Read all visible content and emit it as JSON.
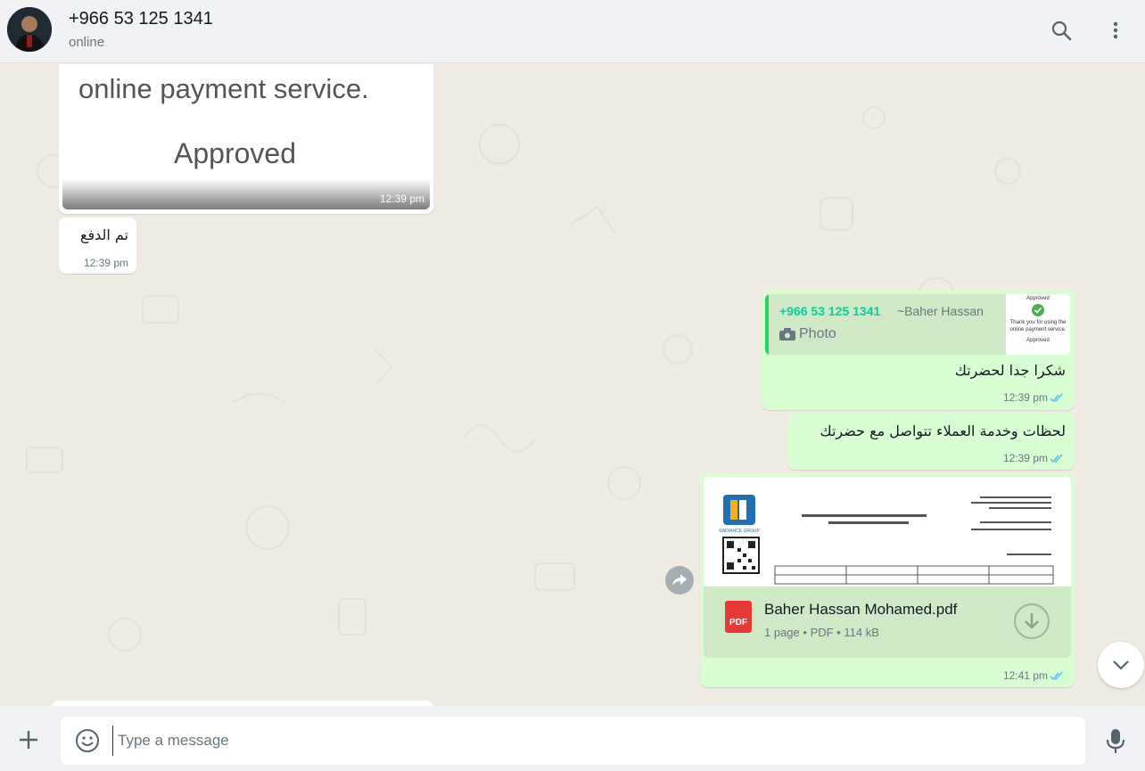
{
  "header": {
    "contact_name": "+966 53 125 1341",
    "status": "online"
  },
  "messages": {
    "image_msg": {
      "line1": "online payment service.",
      "line2": "Approved",
      "time": "12:39 pm"
    },
    "paid_msg": {
      "text": "تم الدفع",
      "time": "12:39 pm"
    },
    "reply_msg": {
      "quote_author": "+966 53 125 1341",
      "quote_name": "~Baher Hassan",
      "quote_type": "Photo",
      "quote_thumb_line1": "Approved",
      "quote_thumb_line2": "Thank you for using the online payment service.",
      "quote_thumb_line3": "Approved",
      "text": "شكرا جدا لحضرتك",
      "time": "12:39 pm"
    },
    "service_msg": {
      "text": "لحظات وخدمة العملاء تتواصل مع حضرتك",
      "time": "12:39 pm"
    },
    "doc_msg": {
      "file_name": "Baher Hassan Mohamed.pdf",
      "pages": "1 page",
      "type": "PDF",
      "size": "114 kB",
      "icon_label": "PDF",
      "logo_text": "RADIANCE GROUP",
      "time": "12:41 pm"
    }
  },
  "composer": {
    "placeholder": "Type a message"
  },
  "icons": {
    "search": "search-icon",
    "menu": "more-vertical-icon",
    "forward": "forward-icon",
    "scroll": "chevron-down-icon",
    "plus": "plus-icon",
    "emoji": "emoji-icon",
    "mic": "mic-icon",
    "ticks": "double-check-icon"
  },
  "colors": {
    "incoming": "#ffffff",
    "outgoing": "#d9fdd3",
    "accent": "#25d366",
    "tick": "#53bdeb"
  }
}
